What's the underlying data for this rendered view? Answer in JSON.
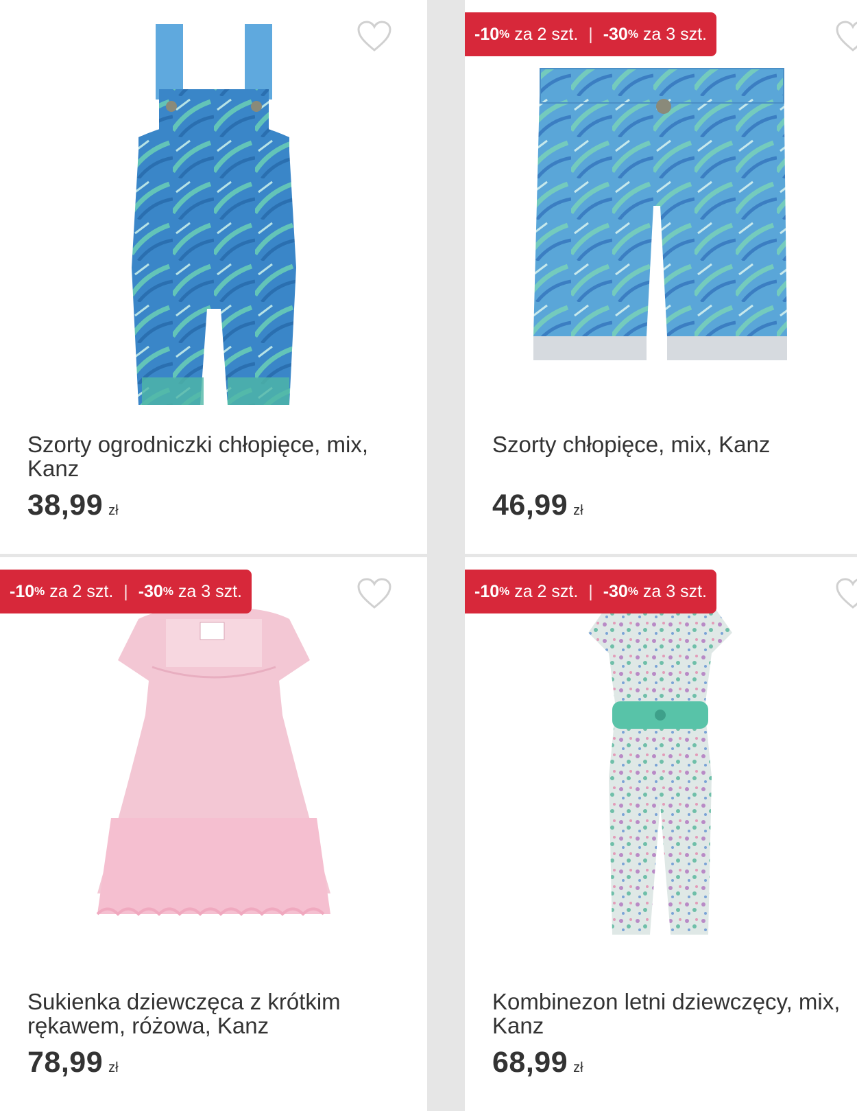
{
  "products": [
    {
      "title": "Szorty ogrodniczki chłopięce, mix, Kanz",
      "price": "38,99",
      "currency": "zł",
      "image_icon": "dungaree-shorts-icon",
      "promo": null
    },
    {
      "title": "Szorty chłopięce, mix, Kanz",
      "price": "46,99",
      "currency": "zł",
      "image_icon": "shorts-icon",
      "promo": {
        "first_discount": "-10",
        "first_unit": "%",
        "first_qty": " za 2 szt. ",
        "separator": "|",
        "second_discount": " -30",
        "second_unit": "%",
        "second_qty": " za 3 szt."
      }
    },
    {
      "title": "Sukienka dziewczęca z krótkim rękawem, różowa, Kanz",
      "price": "78,99",
      "currency": "zł",
      "image_icon": "dress-icon",
      "promo": {
        "first_discount": "-10",
        "first_unit": "%",
        "first_qty": " za 2 szt. ",
        "separator": "|",
        "second_discount": " -30",
        "second_unit": "%",
        "second_qty": " za 3 szt."
      }
    },
    {
      "title": "Kombinezon letni dziewczęcy, mix, Kanz",
      "price": "68,99",
      "currency": "zł",
      "image_icon": "jumpsuit-icon",
      "promo": {
        "first_discount": "-10",
        "first_unit": "%",
        "first_qty": " za 2 szt. ",
        "separator": "|",
        "second_discount": " -30",
        "second_unit": "%",
        "second_qty": " za 3 szt."
      }
    }
  ],
  "colors": {
    "promo_bg": "#d7283a",
    "text": "#333333",
    "heart_outline": "#d0d0d0",
    "card_bg": "#ffffff",
    "grid_gap": "#e6e6e6"
  }
}
